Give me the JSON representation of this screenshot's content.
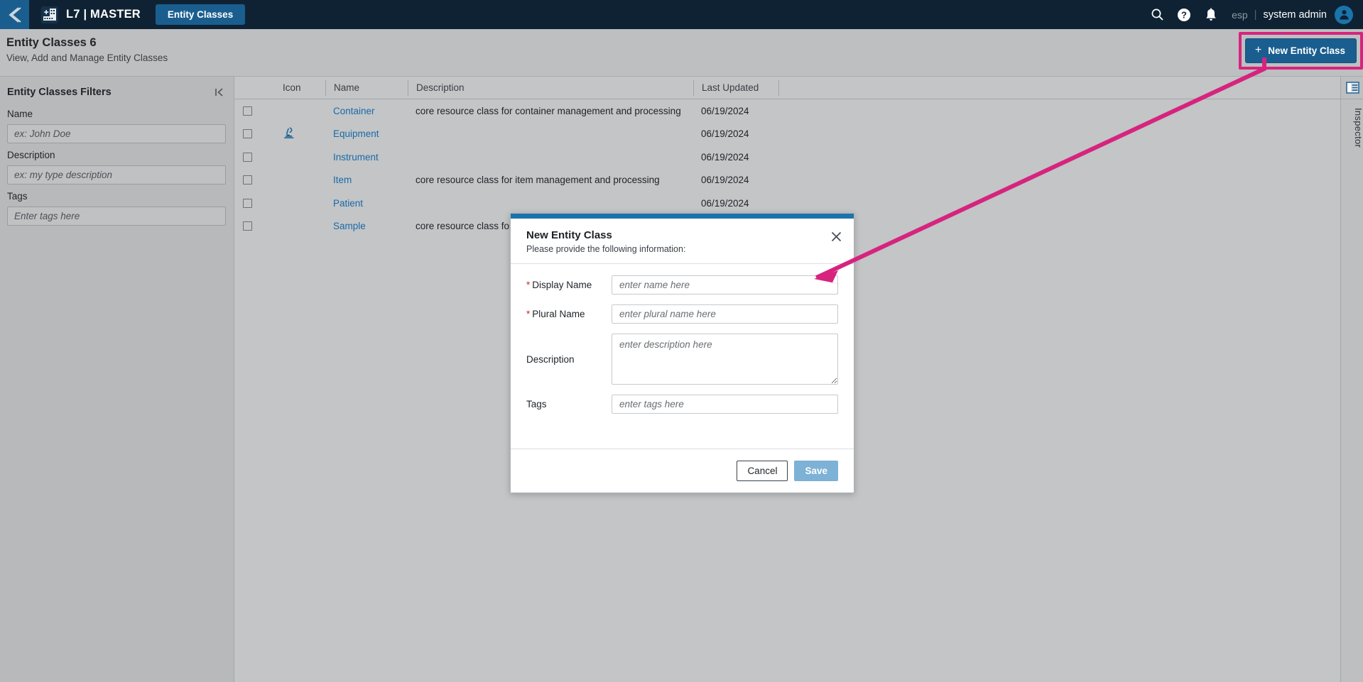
{
  "topnav": {
    "back_icon": "chevron-left-icon",
    "logo_icon": "l7-building-icon",
    "app_title": "L7 | MASTER",
    "active_tab": "Entity Classes",
    "icons": [
      "search-icon",
      "help-icon",
      "notifications-bell-icon"
    ],
    "language": "esp",
    "separator": "|",
    "user_name": "system admin",
    "avatar_icon": "user-avatar-icon"
  },
  "pagehead": {
    "title": "Entity Classes 6",
    "subtitle": "View, Add and Manage Entity Classes",
    "new_button_label": "New Entity Class",
    "new_button_plus": "+",
    "highlight_color": "#d6247e",
    "accent_color": "#1a5e8f"
  },
  "filters": {
    "title": "Entity Classes Filters",
    "collapse_icon": "collapse-panel-icon",
    "fields": [
      {
        "label": "Name",
        "placeholder": "ex: John Doe",
        "value": ""
      },
      {
        "label": "Description",
        "placeholder": "ex: my type description",
        "value": ""
      },
      {
        "label": "Tags",
        "placeholder": "Enter tags here",
        "value": ""
      }
    ]
  },
  "table": {
    "columns": [
      "",
      "Icon",
      "Name",
      "Description",
      "Last Updated",
      ""
    ],
    "rows": [
      {
        "checked": false,
        "icon": "",
        "name": "Container",
        "description": "core resource class for container management and processing",
        "last_updated": "06/19/2024"
      },
      {
        "checked": false,
        "icon": "microscope-icon",
        "name": "Equipment",
        "description": "",
        "last_updated": "06/19/2024"
      },
      {
        "checked": false,
        "icon": "",
        "name": "Instrument",
        "description": "",
        "last_updated": "06/19/2024"
      },
      {
        "checked": false,
        "icon": "",
        "name": "Item",
        "description": "core resource class for item management and processing",
        "last_updated": "06/19/2024"
      },
      {
        "checked": false,
        "icon": "",
        "name": "Patient",
        "description": "",
        "last_updated": "06/19/2024"
      },
      {
        "checked": false,
        "icon": "",
        "name": "Sample",
        "description": "core resource class for sample management and processing",
        "last_updated": "06/19/2024"
      }
    ]
  },
  "inspector": {
    "icon": "inspector-panel-icon",
    "label": "Inspector"
  },
  "modal": {
    "title": "New Entity Class",
    "subtitle": "Please provide the following information:",
    "close_icon": "close-icon",
    "topbar_color": "#1a74ab",
    "fields": [
      {
        "label": "Display Name",
        "required": true,
        "placeholder": "enter name here",
        "value": "",
        "type": "text"
      },
      {
        "label": "Plural Name",
        "required": true,
        "placeholder": "enter plural name here",
        "value": "",
        "type": "text"
      },
      {
        "label": "Description",
        "required": false,
        "placeholder": "enter description here",
        "value": "",
        "type": "textarea"
      },
      {
        "label": "Tags",
        "required": false,
        "placeholder": "enter tags here",
        "value": "",
        "type": "text"
      }
    ],
    "required_marker": "*",
    "cancel_label": "Cancel",
    "save_label": "Save"
  },
  "annotation": {
    "type": "arrow",
    "color": "#d6247e",
    "from": "new-entity-class-button",
    "to": "display-name-field"
  }
}
